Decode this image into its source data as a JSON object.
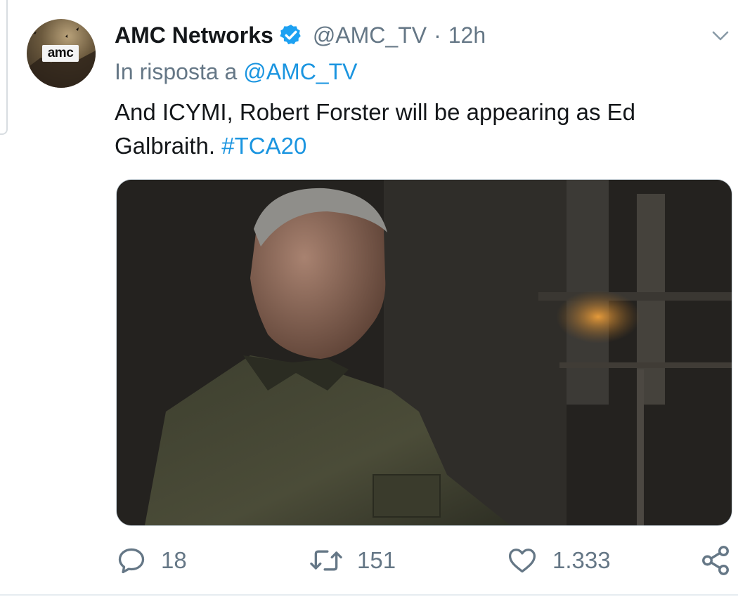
{
  "tweet": {
    "author_name": "AMC Networks",
    "handle": "@AMC_TV",
    "separator": "·",
    "time": "12h",
    "reply_prefix": "In risposta a",
    "reply_to": "@AMC_TV",
    "text": "And ICYMI, Robert Forster will be appearing as Ed Galbraith.",
    "hashtag": "#TCA20"
  },
  "avatar": {
    "logo_text": "amc"
  },
  "actions": {
    "replies": "18",
    "retweets": "151",
    "likes": "1.333"
  },
  "icons": {
    "verified": "verified-badge-icon",
    "menu": "chevron-down-icon",
    "reply": "reply-bubble-icon",
    "retweet": "retweet-icon",
    "like": "heart-icon",
    "share": "share-icon"
  },
  "colors": {
    "accent": "#1b95e0",
    "text": "#14171a",
    "muted": "#657786"
  }
}
